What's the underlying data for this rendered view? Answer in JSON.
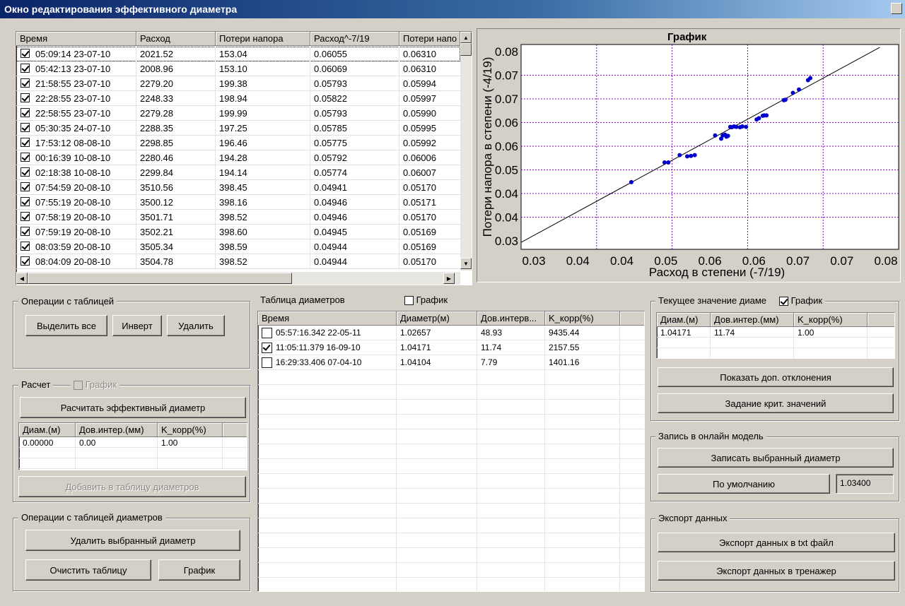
{
  "window": {
    "title": "Окно редактирования эффективного диаметра"
  },
  "main_table": {
    "columns": [
      "Время",
      "Расход",
      "Потери напора",
      "Расход^-7/19",
      "Потери напо"
    ],
    "rows": [
      {
        "checked": true,
        "time": "05:09:14 23-07-10",
        "flow": "2021.52",
        "loss": "153.04",
        "flow_pow": "0.06055",
        "loss_pow": "0.06310"
      },
      {
        "checked": true,
        "time": "05:42:13 23-07-10",
        "flow": "2008.96",
        "loss": "153.10",
        "flow_pow": "0.06069",
        "loss_pow": "0.06310"
      },
      {
        "checked": true,
        "time": "21:58:55 23-07-10",
        "flow": "2279.20",
        "loss": "199.38",
        "flow_pow": "0.05793",
        "loss_pow": "0.05994"
      },
      {
        "checked": true,
        "time": "22:28:55 23-07-10",
        "flow": "2248.33",
        "loss": "198.94",
        "flow_pow": "0.05822",
        "loss_pow": "0.05997"
      },
      {
        "checked": true,
        "time": "22:58:55 23-07-10",
        "flow": "2279.28",
        "loss": "199.99",
        "flow_pow": "0.05793",
        "loss_pow": "0.05990"
      },
      {
        "checked": true,
        "time": "05:30:35 24-07-10",
        "flow": "2288.35",
        "loss": "197.25",
        "flow_pow": "0.05785",
        "loss_pow": "0.05995"
      },
      {
        "checked": true,
        "time": "17:53:12 08-08-10",
        "flow": "2298.85",
        "loss": "196.46",
        "flow_pow": "0.05775",
        "loss_pow": "0.05992"
      },
      {
        "checked": true,
        "time": "00:16:39 10-08-10",
        "flow": "2280.46",
        "loss": "194.28",
        "flow_pow": "0.05792",
        "loss_pow": "0.06006"
      },
      {
        "checked": true,
        "time": "02:18:38 10-08-10",
        "flow": "2299.84",
        "loss": "194.14",
        "flow_pow": "0.05774",
        "loss_pow": "0.06007"
      },
      {
        "checked": true,
        "time": "07:54:59 20-08-10",
        "flow": "3510.56",
        "loss": "398.45",
        "flow_pow": "0.04941",
        "loss_pow": "0.05170"
      },
      {
        "checked": true,
        "time": "07:55:19 20-08-10",
        "flow": "3500.12",
        "loss": "398.16",
        "flow_pow": "0.04946",
        "loss_pow": "0.05171"
      },
      {
        "checked": true,
        "time": "07:58:19 20-08-10",
        "flow": "3501.71",
        "loss": "398.52",
        "flow_pow": "0.04946",
        "loss_pow": "0.05170"
      },
      {
        "checked": true,
        "time": "07:59:19 20-08-10",
        "flow": "3502.21",
        "loss": "398.60",
        "flow_pow": "0.04945",
        "loss_pow": "0.05169"
      },
      {
        "checked": true,
        "time": "08:03:59 20-08-10",
        "flow": "3505.34",
        "loss": "398.59",
        "flow_pow": "0.04944",
        "loss_pow": "0.05169"
      },
      {
        "checked": true,
        "time": "08:04:09 20-08-10",
        "flow": "3504.78",
        "loss": "398.52",
        "flow_pow": "0.04944",
        "loss_pow": "0.05170"
      }
    ]
  },
  "chart_data": {
    "type": "scatter",
    "title": "График",
    "xlabel": "Расход в степени (-7/19)",
    "ylabel": "Потери напора в степени (-4/19)",
    "x_tick_labels": [
      "0.03",
      "0.04",
      "0.04",
      "0.05",
      "0.06",
      "0.06",
      "0.07",
      "0.07",
      "0.08"
    ],
    "y_tick_labels": [
      "0.08",
      "0.07",
      "0.07",
      "0.06",
      "0.06",
      "0.05",
      "0.04",
      "0.04",
      "0.03"
    ],
    "xlim": [
      0.03,
      0.08
    ],
    "ylim": [
      0.03,
      0.08
    ],
    "grid": true,
    "point_color": "#0000cc",
    "line_color": "#000000",
    "grid_color": "#8000c0",
    "line": [
      [
        0.03,
        0.0317
      ],
      [
        0.0775,
        0.0793
      ]
    ],
    "points": [
      [
        0.0446,
        0.0464
      ],
      [
        0.049,
        0.0512
      ],
      [
        0.0495,
        0.0512
      ],
      [
        0.051,
        0.053
      ],
      [
        0.052,
        0.0527
      ],
      [
        0.0525,
        0.0528
      ],
      [
        0.053,
        0.053
      ],
      [
        0.0557,
        0.0578
      ],
      [
        0.0565,
        0.057
      ],
      [
        0.0567,
        0.0578
      ],
      [
        0.057,
        0.058
      ],
      [
        0.0572,
        0.0575
      ],
      [
        0.0574,
        0.0577
      ],
      [
        0.0577,
        0.0599
      ],
      [
        0.0579,
        0.0598
      ],
      [
        0.0582,
        0.06
      ],
      [
        0.0585,
        0.0599
      ],
      [
        0.059,
        0.0598
      ],
      [
        0.0593,
        0.06
      ],
      [
        0.0598,
        0.0599
      ],
      [
        0.0612,
        0.0617
      ],
      [
        0.0615,
        0.062
      ],
      [
        0.062,
        0.0626
      ],
      [
        0.0622,
        0.0627
      ],
      [
        0.0625,
        0.0627
      ],
      [
        0.0648,
        0.0664
      ],
      [
        0.065,
        0.0665
      ],
      [
        0.066,
        0.0682
      ],
      [
        0.0668,
        0.069
      ],
      [
        0.068,
        0.0713
      ],
      [
        0.0683,
        0.0718
      ]
    ]
  },
  "table_ops": {
    "label": "Операции с таблицей",
    "select_all": "Выделить все",
    "invert": "Инверт",
    "delete": "Удалить"
  },
  "calc": {
    "label": "Расчет",
    "graph_label": "График",
    "graph_checked": false,
    "calc_button": "Расчитать эффективный диаметр",
    "columns": [
      "Диам.(м)",
      "Дов.интер.(мм)",
      "K_корр(%)"
    ],
    "row": [
      "0.00000",
      "0.00",
      "1.00"
    ],
    "add_button": "Добавить в таблицу диаметров"
  },
  "diam_ops": {
    "label": "Операции с таблицей диаметров",
    "delete_selected": "Удалить выбранный диаметр",
    "clear": "Очистить таблицу",
    "graph": "График"
  },
  "diam_table": {
    "label": "Таблица диаметров",
    "graph_label": "График",
    "graph_checked": false,
    "columns": [
      "Время",
      "Диаметр(м)",
      "Дов.интерв...",
      "K_корр(%)"
    ],
    "rows": [
      {
        "checked": false,
        "time": "05:57:16.342 22-05-11",
        "diam": "1.02657",
        "interval": "48.93",
        "k": "9435.44"
      },
      {
        "checked": true,
        "time": "11:05:11.379 16-09-10",
        "diam": "1.04171",
        "interval": "11.74",
        "k": "2157.55"
      },
      {
        "checked": false,
        "time": "16:29:33.406 07-04-10",
        "diam": "1.04104",
        "interval": "7.79",
        "k": "1401.16"
      }
    ]
  },
  "current": {
    "label": "Текущее значение диаме",
    "graph_label": "График",
    "graph_checked": true,
    "columns": [
      "Диам.(м)",
      "Дов.интер.(мм)",
      "K_корр(%)"
    ],
    "row": [
      "1.04171",
      "11.74",
      "1.00"
    ],
    "show_dev": "Показать доп. отклонения",
    "set_crit": "Задание крит. значений"
  },
  "online": {
    "label": "Запись в онлайн модель",
    "write": "Записать выбранный диаметр",
    "default": "По умолчанию",
    "default_value": "1.03400"
  },
  "export": {
    "label": "Экспорт данных",
    "txt": "Экспорт данных в txt файл",
    "trainer": "Экспорт данных в тренажер"
  }
}
